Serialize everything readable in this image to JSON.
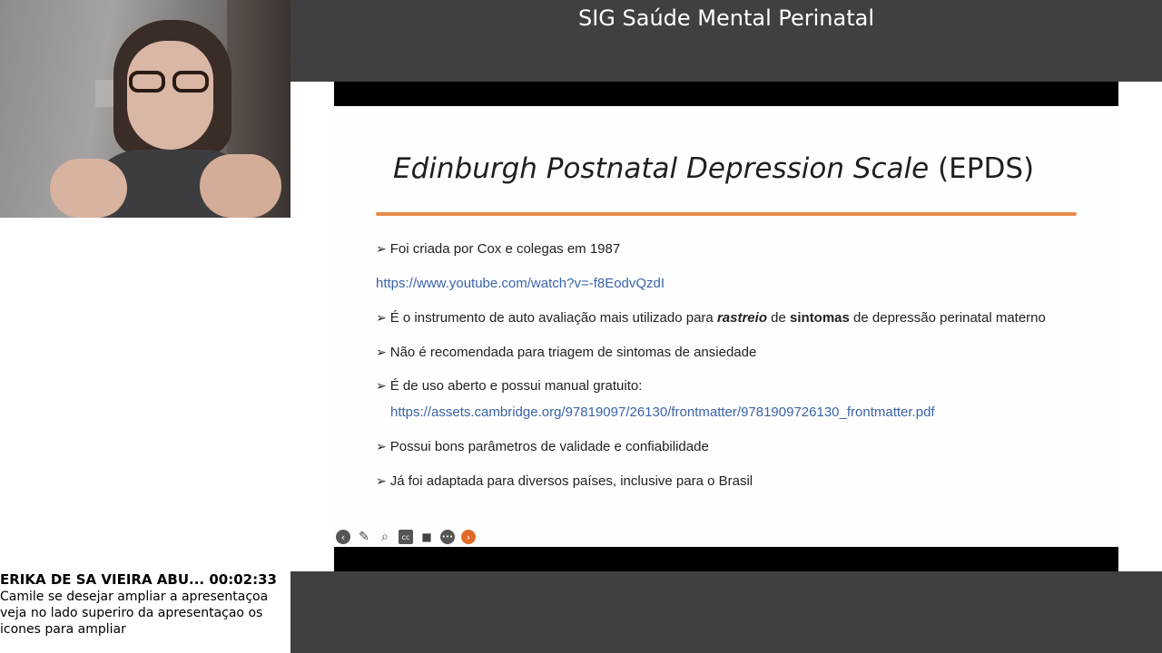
{
  "window": {
    "title": "SIG Saúde Mental Perinatal"
  },
  "slide": {
    "title_italic": "Edinburgh Postnatal Depression Scale",
    "title_suffix": " (EPDS)",
    "bullets": [
      {
        "text": "Foi criada por Cox e colegas em 1987"
      },
      {
        "link": "https://www.youtube.com/watch?v=-f8EodvQzdI"
      },
      {
        "pre": "É o instrumento de auto avaliação mais utilizado para ",
        "em": "rastreio",
        "mid": " de ",
        "strong": "sintomas",
        "post": " de depressão perinatal materno"
      },
      {
        "text": "Não é recomendada para triagem de sintomas de ansiedade"
      },
      {
        "text": "É de uso aberto e possui manual gratuito:"
      },
      {
        "link": "https://assets.cambridge.org/97819097/26130/frontmatter/9781909726130_frontmatter.pdf"
      },
      {
        "text": "Possui bons parâmetros de validade e confiabilidade"
      },
      {
        "text": "Já foi adaptada para diversos países, inclusive para o Brasil"
      }
    ]
  },
  "controls": {
    "icons": [
      "back-icon",
      "pen-icon",
      "zoom-icon",
      "captions-icon",
      "camera-icon",
      "more-icon",
      "next-icon"
    ],
    "glyphs": [
      "‹",
      "✎",
      "⌕",
      "cc",
      "■",
      "•••",
      "›"
    ]
  },
  "chat": {
    "sender": "ERIKA DE SA VIEIRA ABU... 00:02:33",
    "message": "Camile se desejar ampliar a apresentaçoa veja no lado superiro da apresentaçao os icones para ampliar"
  },
  "colors": {
    "accent_orange": "#e98a4b",
    "link_blue": "#3b63a8",
    "dark_panel": "#404040"
  }
}
